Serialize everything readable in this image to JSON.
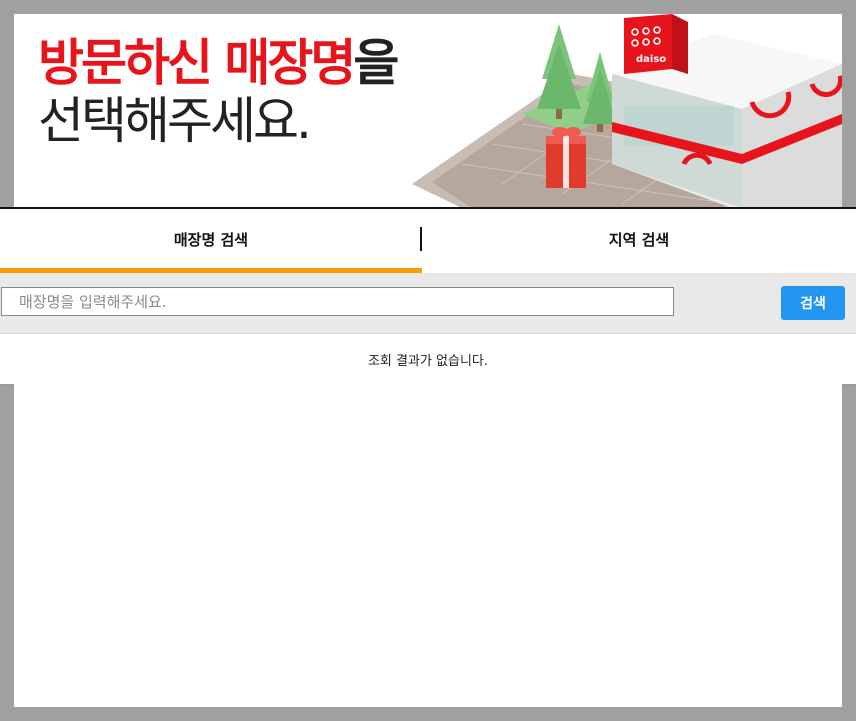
{
  "banner": {
    "headline_red": "방문하신 매장명",
    "headline_suffix": "을",
    "headline_line2": "선택해주세요.",
    "store_sign": "daiso",
    "colors": {
      "accent_red": "#e8141c",
      "tab_indicator": "#f5a000",
      "button_blue": "#2196f3"
    }
  },
  "tabs": [
    {
      "label": "매장명 검색",
      "active": true
    },
    {
      "label": "지역 검색",
      "active": false
    }
  ],
  "search": {
    "placeholder": "매장명을 입력해주세요.",
    "value": "",
    "button_label": "검색",
    "button_icon": "none"
  },
  "results": {
    "empty_message": "조회 결과가 없습니다."
  }
}
